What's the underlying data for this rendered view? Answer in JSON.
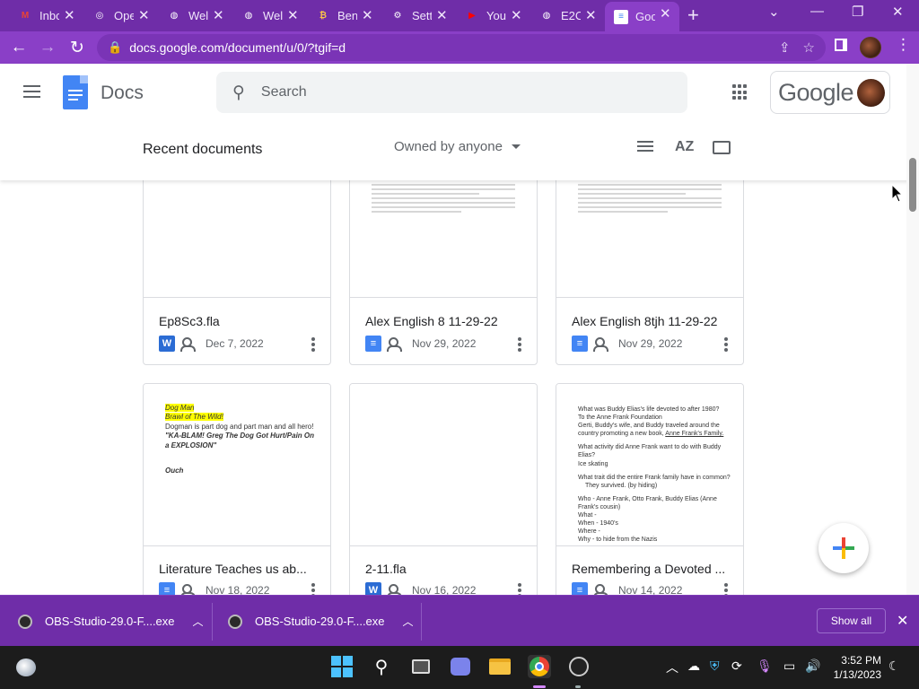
{
  "browser": {
    "tabs": [
      {
        "label": "Inbox",
        "icon": "gmail-icon",
        "color": "#ea4335",
        "glyph": "M"
      },
      {
        "label": "Open",
        "icon": "obs-icon",
        "color": "#2a2a2a",
        "glyph": "◎"
      },
      {
        "label": "Welcome",
        "icon": "globe-icon",
        "color": "#ffffff",
        "glyph": "◍"
      },
      {
        "label": "Welcome",
        "icon": "globe-icon",
        "color": "#ffffff",
        "glyph": "◍"
      },
      {
        "label": "Ben",
        "icon": "bitcoin-icon",
        "color": "#f7c24a",
        "glyph": "₿"
      },
      {
        "label": "Settings",
        "icon": "gear-icon",
        "color": "#ffffff",
        "glyph": "⚙"
      },
      {
        "label": "YouTube",
        "icon": "youtube-icon",
        "color": "#ff0000",
        "glyph": "▶"
      },
      {
        "label": "E2C",
        "icon": "globe-icon",
        "color": "#ffffff",
        "glyph": "◍"
      },
      {
        "label": "Google Docs",
        "icon": "docs-icon",
        "color": "#4285f4",
        "glyph": "≡"
      }
    ],
    "url": "docs.google.com/document/u/0/?tgif=d"
  },
  "docs": {
    "app_name": "Docs",
    "search_placeholder": "Search",
    "brand": "Google",
    "section_title": "Recent documents",
    "owner_filter": "Owned by anyone",
    "sort_label": "AZ"
  },
  "documents": [
    {
      "title": "Ep8Sc3.fla",
      "date": "Dec 7, 2022",
      "type": "word"
    },
    {
      "title": "Alex English 8 11-29-22",
      "date": "Nov 29, 2022",
      "type": "doc"
    },
    {
      "title": "Alex English 8tjh 11-29-22",
      "date": "Nov 29, 2022",
      "type": "doc"
    },
    {
      "title": "Literature Teaches us ab...",
      "date": "Nov 18, 2022",
      "type": "doc"
    },
    {
      "title": "2-11.fla",
      "date": "Nov 16, 2022",
      "type": "word"
    },
    {
      "title": "Remembering a Devoted ...",
      "date": "Nov 14, 2022",
      "type": "doc"
    }
  ],
  "thumbs": {
    "lit": {
      "l1": "Dog Man",
      "l2": "Brawl of The Wild!",
      "l3": "Dogman is part dog and part man and all hero!",
      "l4": "\"KA-BLAM! Greg The Dog Got Hurt/Pain On a EXPLOSION\"",
      "l5": "Ouch"
    },
    "remember": {
      "l1": "What was Buddy Elias's life devoted to after 1980?",
      "l2": "To the Anne Frank Foundation",
      "l3": "Gerti, Buddy's wife, and Buddy traveled around the country promoting a new book,",
      "l3u": "Anne Frank's Family.",
      "l4": "What activity did Anne Frank want to do with Buddy Elias?",
      "l5": "Ice skating",
      "l6": "What trait did the entire Frank family have in common?",
      "l7": "They survived. (by hiding)",
      "l8": "Who - Anne Frank, Otto Frank, Buddy Elias (Anne Frank's cousin)",
      "l9": "What -",
      "l10": "When - 1940's",
      "l11": "Where -",
      "l12": "Why - to hide from the Nazis"
    }
  },
  "downloads": {
    "items": [
      "OBS-Studio-29.0-F....exe",
      "OBS-Studio-29.0-F....exe"
    ],
    "show_all": "Show all"
  },
  "taskbar": {
    "time": "3:52 PM",
    "date": "1/13/2023"
  }
}
